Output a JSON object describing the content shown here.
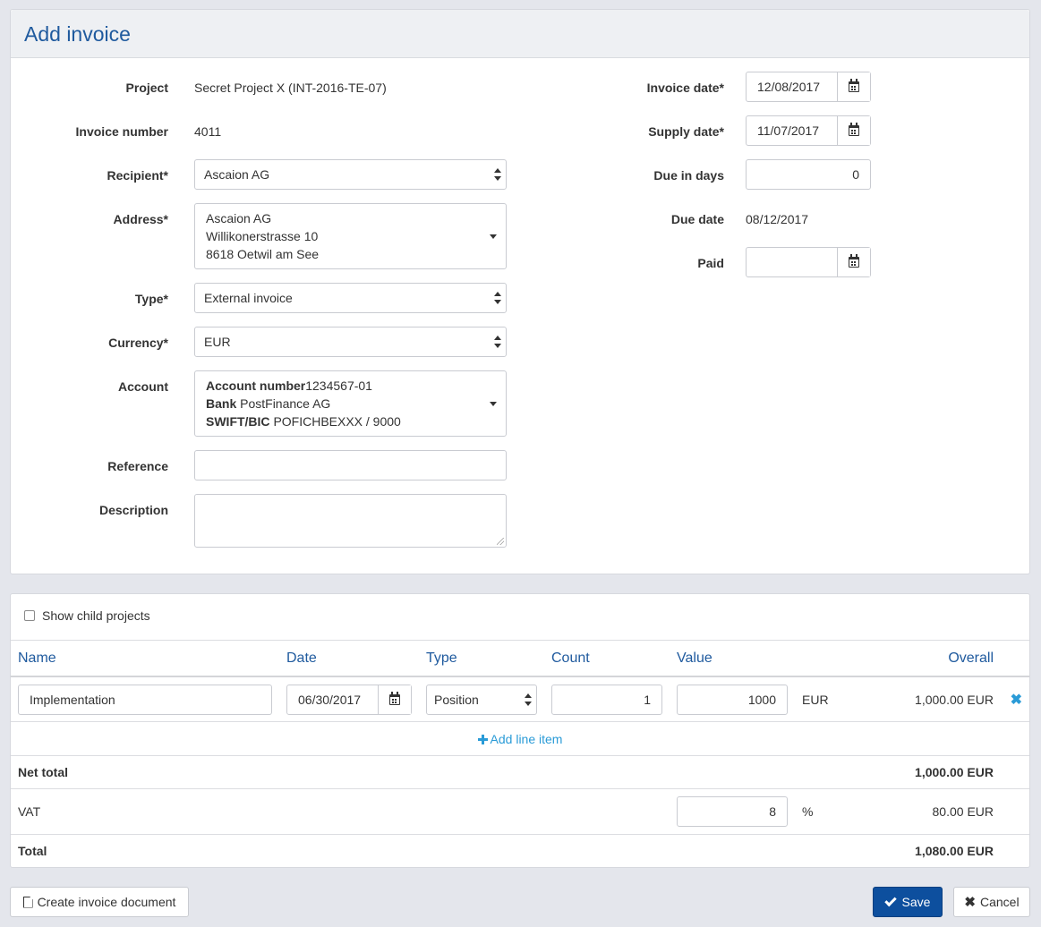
{
  "header": {
    "title": "Add invoice"
  },
  "form": {
    "project": {
      "label": "Project",
      "value": "Secret Project X (INT-2016-TE-07)"
    },
    "invoice_number": {
      "label": "Invoice number",
      "value": "4011"
    },
    "recipient": {
      "label": "Recipient*",
      "value": "Ascaion AG"
    },
    "address": {
      "label": "Address*",
      "lines": [
        "Ascaion AG",
        "Willikonerstrasse 10",
        "8618 Oetwil am See"
      ]
    },
    "type": {
      "label": "Type*",
      "value": "External invoice"
    },
    "currency": {
      "label": "Currency*",
      "value": "EUR"
    },
    "account": {
      "label": "Account",
      "number_label": "Account number",
      "number_value": "1234567-01",
      "bank_label": "Bank",
      "bank_value": "PostFinance AG",
      "swift_label": "SWIFT/BIC",
      "swift_value": "POFICHBEXXX / 9000"
    },
    "reference": {
      "label": "Reference",
      "value": ""
    },
    "description": {
      "label": "Description",
      "value": ""
    },
    "invoice_date": {
      "label": "Invoice date*",
      "value": "12/08/2017"
    },
    "supply_date": {
      "label": "Supply date*",
      "value": "11/07/2017"
    },
    "due_in_days": {
      "label": "Due in days",
      "value": "0"
    },
    "due_date": {
      "label": "Due date",
      "value": "08/12/2017"
    },
    "paid": {
      "label": "Paid",
      "value": ""
    }
  },
  "items": {
    "show_child_label": "Show child projects",
    "columns": {
      "name": "Name",
      "date": "Date",
      "type": "Type",
      "count": "Count",
      "value": "Value",
      "overall": "Overall"
    },
    "rows": [
      {
        "name": "Implementation",
        "date": "06/30/2017",
        "type": "Position",
        "count": "1",
        "value": "1000",
        "currency": "EUR",
        "overall": "1,000.00 EUR"
      }
    ],
    "add_line_item": "Add line item",
    "net_total_label": "Net total",
    "net_total_value": "1,000.00 EUR",
    "vat_label": "VAT",
    "vat_rate": "8",
    "vat_unit": "%",
    "vat_value": "80.00 EUR",
    "total_label": "Total",
    "total_value": "1,080.00 EUR"
  },
  "actions": {
    "create_document": "Create invoice document",
    "save": "Save",
    "cancel": "Cancel"
  },
  "colors": {
    "accent": "#1f5a9e",
    "link": "#2a9bd7",
    "primary_button": "#0d4f9e"
  }
}
